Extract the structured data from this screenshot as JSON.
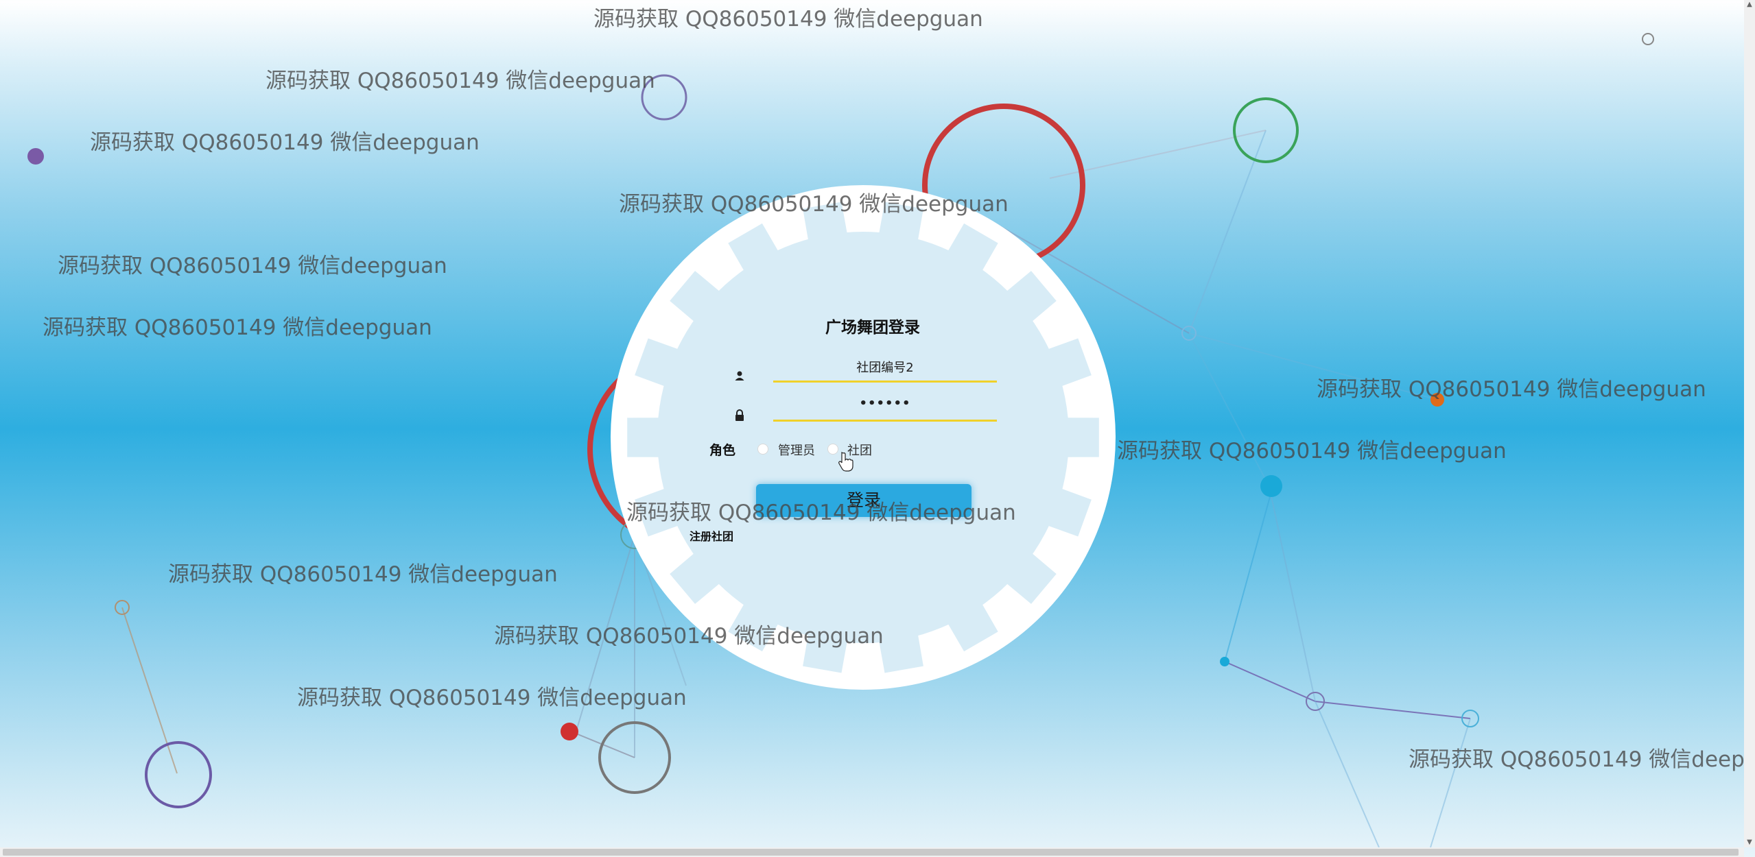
{
  "watermark_text": "源码获取 QQ86050149 微信deepguan",
  "watermark_text_cut": "源码获取 QQ86050149 微信deepgu",
  "login": {
    "title": "广场舞团登录",
    "username_value": "社团编号2",
    "password_value": "••••••",
    "role_label": "角色",
    "role_options": [
      "管理员",
      "社团"
    ],
    "submit_label": "登录",
    "register_link": "注册社团"
  },
  "icons": {
    "user": "user-icon",
    "password": "lock-icon",
    "cursor": "pointer-hand-icon"
  },
  "colors": {
    "accent_line": "#f0d12a",
    "button": "#2ba9e0",
    "panel": "#d8ecf6",
    "ring_red": "#c83a3a",
    "ring_green": "#3aa35a",
    "ring_purple": "#6b5aa6",
    "node_orange": "#e06a1a",
    "node_blue": "#1aa9d8"
  }
}
